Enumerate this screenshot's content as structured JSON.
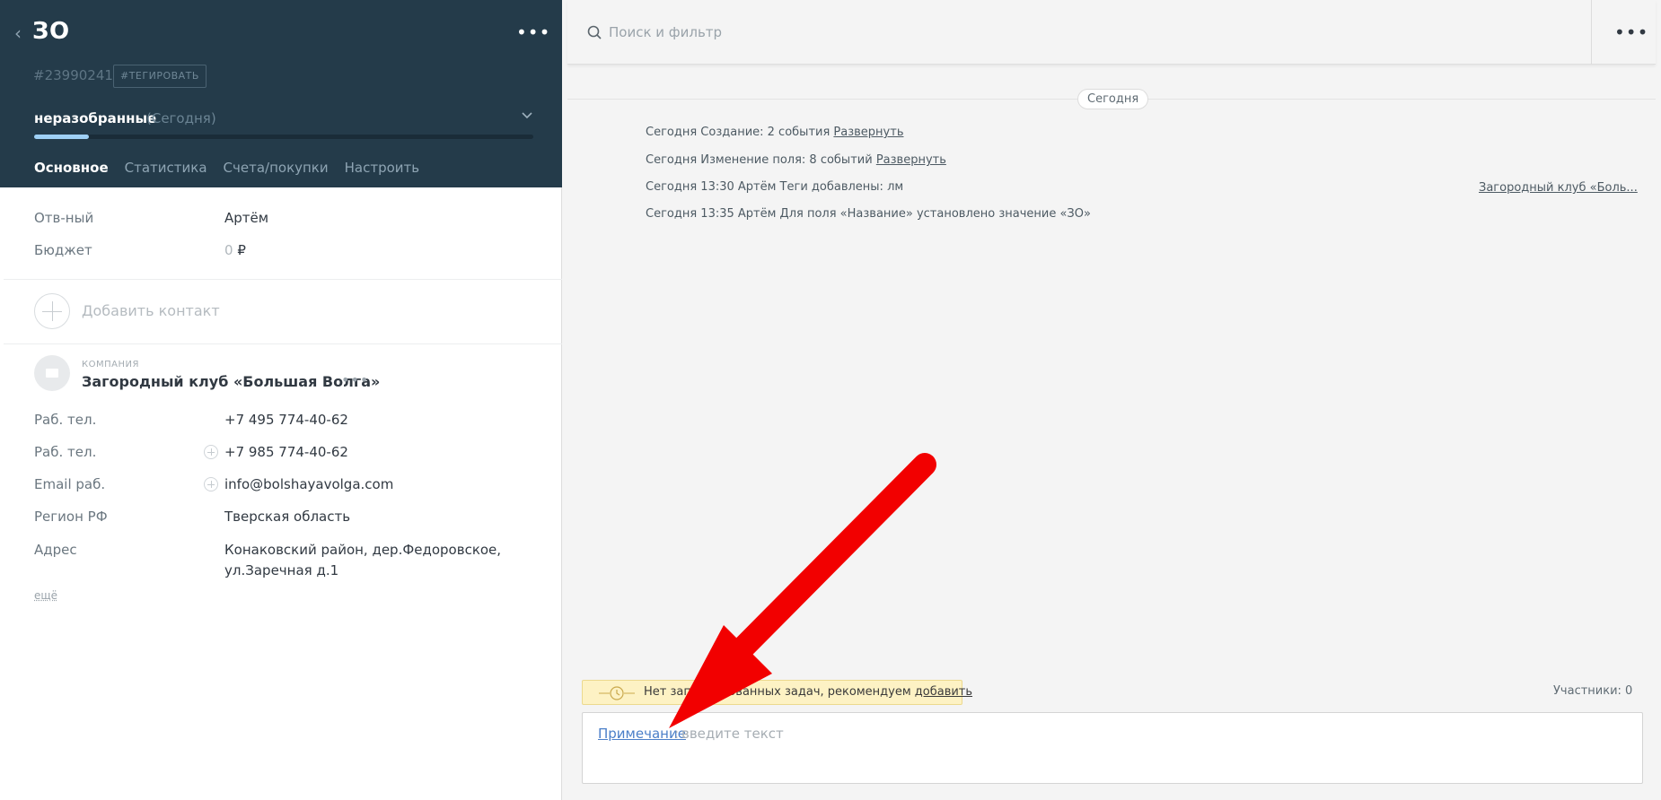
{
  "lead": {
    "title": "ЗО",
    "id": "#23990241",
    "tag_button": "#ТЕГИРОВАТЬ",
    "status_name": "неразобранные",
    "status_date": "(Сегодня)",
    "progress": 0.11,
    "tabs": [
      {
        "label": "Основное",
        "active": true
      },
      {
        "label": "Статистика",
        "active": false
      },
      {
        "label": "Счета/покупки",
        "active": false
      },
      {
        "label": "Настроить",
        "active": false
      }
    ]
  },
  "fields": {
    "responsible_label": "Отв-ный",
    "responsible_value": "Артём",
    "budget_label": "Бюджет",
    "budget_value": "0",
    "budget_currency": "₽"
  },
  "add_contact": {
    "label": "Добавить контакт"
  },
  "company": {
    "kind": "КОМПАНИЯ",
    "name": "Загородный клуб «Большая Волга»",
    "phone1_label": "Раб. тел.",
    "phone1_value": "+7 495 774-40-62",
    "phone2_label": "Раб. тел.",
    "phone2_value": "+7 985 774-40-62",
    "email_label": "Email раб.",
    "email_value": "info@bolshayavolga.com",
    "region_label": "Регион РФ",
    "region_value": "Тверская область",
    "address_label": "Адрес",
    "address_line1": "Конаковский район, дер.Федоровское,",
    "address_line2": "ул.Заречная д.1",
    "more": "ещё"
  },
  "feed": {
    "search_placeholder": "Поиск и фильтр",
    "date_divider": "Сегодня",
    "events": [
      {
        "text": "Сегодня Создание: 2 события ",
        "link": "Развернуть"
      },
      {
        "text": "Сегодня Изменение поля: 8 событий ",
        "link": "Развернуть"
      },
      {
        "text": "Сегодня 13:30 Артём Теги добавлены: лм",
        "link": ""
      },
      {
        "text": "Сегодня 13:35 Артём Для поля «Название» установлено значение «ЗО»",
        "link": ""
      }
    ],
    "event_company_link": "Загородный клуб «Боль...",
    "task_notice_text": "Нет запланированных задач, рекомендуем ",
    "task_notice_link": "добавить",
    "participants": "Участники: 0",
    "note_type": "Примечание",
    "note_colon": ":",
    "note_placeholder": "введите текст"
  },
  "colors": {
    "header_bg": "#243b4a",
    "progress_fill": "#9ed0f5",
    "link_blue": "#4b7fc8",
    "notice_bg": "#fdf2c4",
    "arrow_red": "#f20000"
  }
}
